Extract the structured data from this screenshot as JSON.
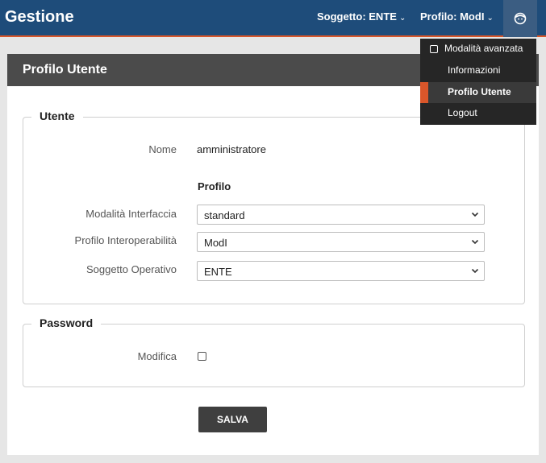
{
  "app": {
    "title": "Gestione"
  },
  "topbar": {
    "soggetto_menu": "Soggetto: ENTE",
    "profilo_menu": "Profilo: ModI",
    "user_icon": "user-face-icon"
  },
  "user_dropdown": {
    "items": [
      {
        "label": "Modalità avanzata",
        "type": "checkbox",
        "checked": false
      },
      {
        "label": "Informazioni"
      },
      {
        "label": "Profilo Utente",
        "active": true
      },
      {
        "label": "Logout"
      }
    ]
  },
  "page": {
    "title": "Profilo Utente"
  },
  "utente": {
    "legend": "Utente",
    "nome_label": "Nome",
    "nome_value": "amministratore",
    "profilo_heading": "Profilo",
    "fields": [
      {
        "label": "Modalità Interfaccia",
        "value": "standard"
      },
      {
        "label": "Profilo Interoperabilità",
        "value": "ModI"
      },
      {
        "label": "Soggetto Operativo",
        "value": "ENTE"
      }
    ]
  },
  "password": {
    "legend": "Password",
    "modifica_label": "Modifica",
    "modifica_checked": false
  },
  "actions": {
    "save_label": "SALVA"
  },
  "colors": {
    "header_blue": "#1e4c7a",
    "accent_orange": "#d9562a",
    "panel_header": "#4b4b4b"
  }
}
